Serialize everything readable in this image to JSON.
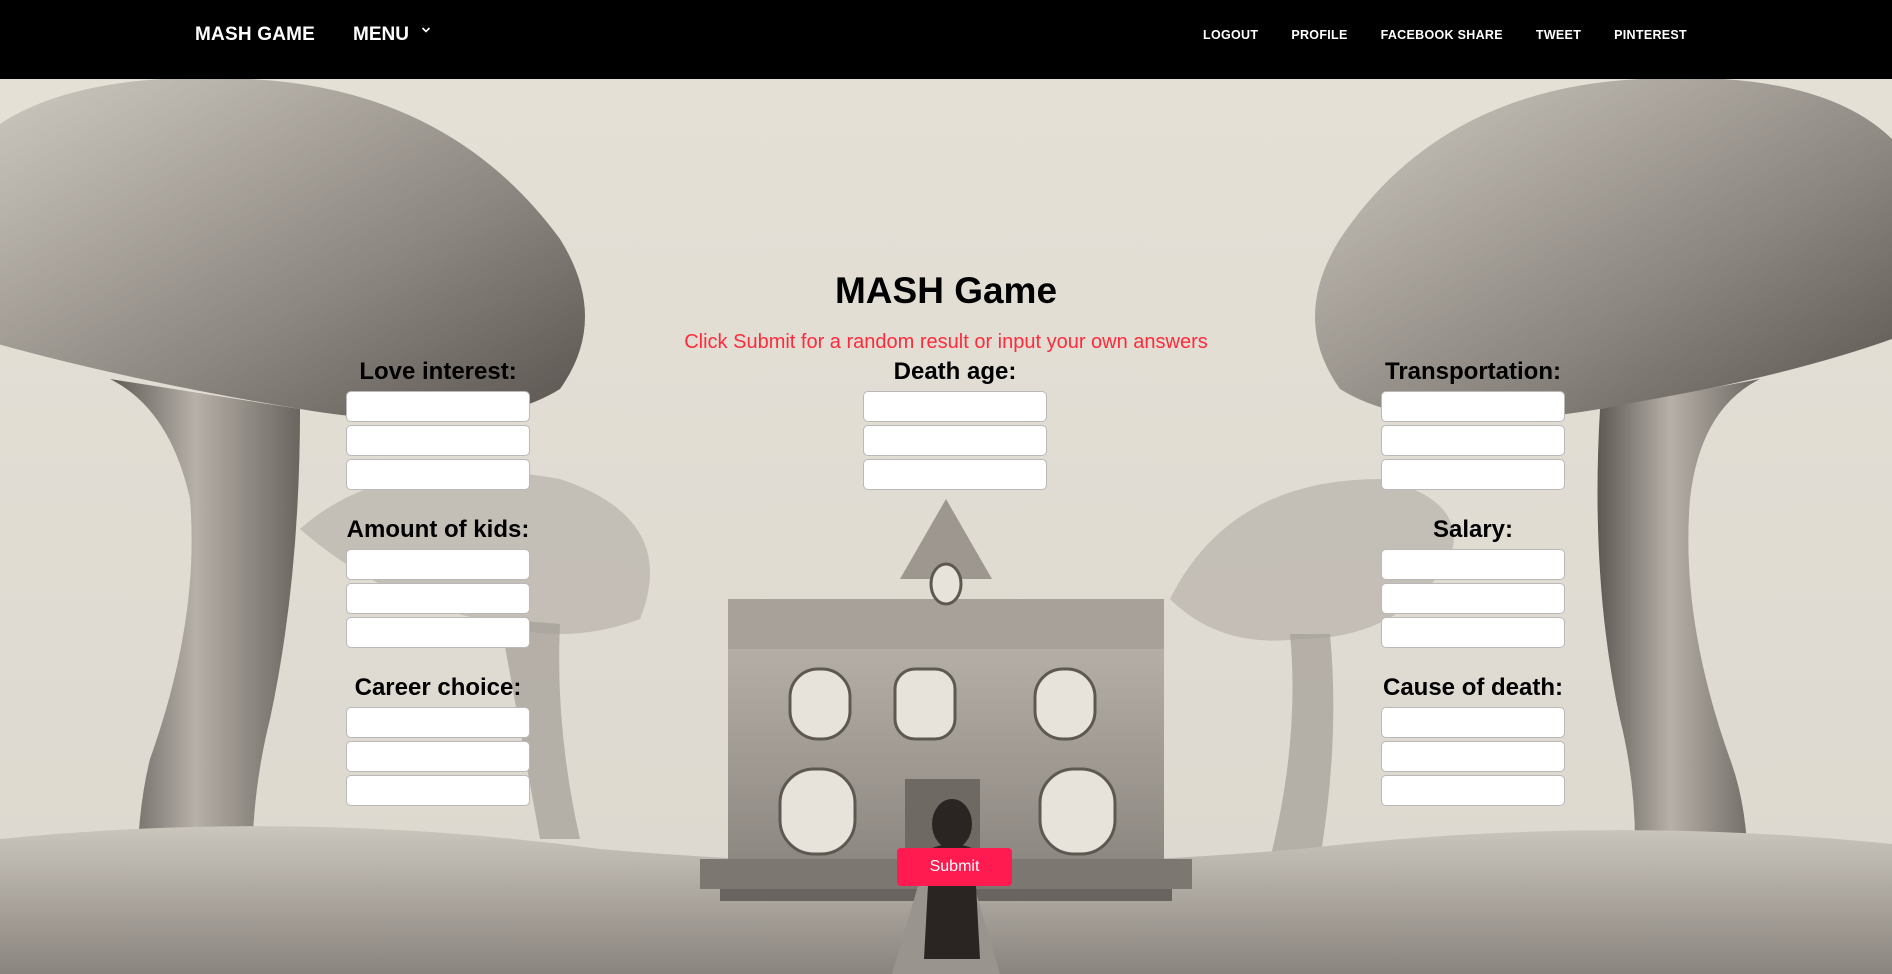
{
  "nav": {
    "brand": "MASH GAME",
    "menu_label": "MENU",
    "links": [
      "LOGOUT",
      "PROFILE",
      "FACEBOOK SHARE",
      "TWEET",
      "PINTEREST"
    ]
  },
  "page": {
    "title": "MASH Game",
    "subtitle": "Click Submit for a random result or input your own answers"
  },
  "groups": {
    "love_interest": {
      "label": "Love interest:",
      "inputs": [
        "",
        "",
        ""
      ]
    },
    "amount_of_kids": {
      "label": "Amount of kids:",
      "inputs": [
        "",
        "",
        ""
      ]
    },
    "career_choice": {
      "label": "Career choice:",
      "inputs": [
        "",
        "",
        ""
      ]
    },
    "death_age": {
      "label": "Death age:",
      "inputs": [
        "",
        "",
        ""
      ]
    },
    "transportation": {
      "label": "Transportation:",
      "inputs": [
        "",
        "",
        ""
      ]
    },
    "salary": {
      "label": "Salary:",
      "inputs": [
        "",
        "",
        ""
      ]
    },
    "cause_of_death": {
      "label": "Cause of death:",
      "inputs": [
        "",
        "",
        ""
      ]
    }
  },
  "submit_label": "Submit",
  "colors": {
    "navbar_bg": "#000000",
    "subtitle": "#ff2a3c",
    "submit_bg": "#ff1a4f",
    "background": "#e6e2d9"
  },
  "icons": {
    "menu_dropdown": "chevron-down-icon"
  }
}
